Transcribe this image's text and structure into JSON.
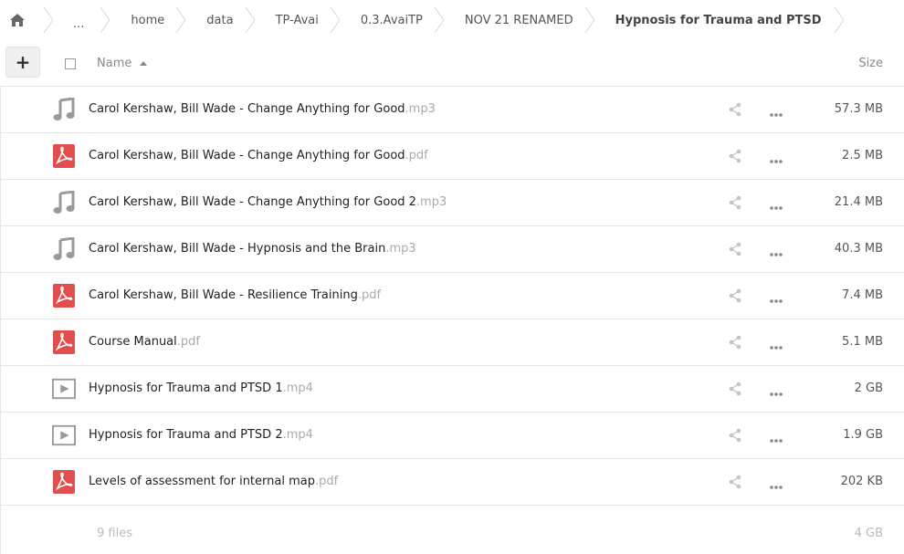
{
  "breadcrumb": {
    "home_icon": "home-icon",
    "ellipsis": "...",
    "items": [
      "home",
      "data",
      "TP-Avai",
      "0.3.AvaiTP",
      "NOV 21 RENAMED"
    ],
    "current": "Hypnosis for Trauma and PTSD"
  },
  "header": {
    "add_label": "+",
    "name_label": "Name",
    "size_label": "Size"
  },
  "files": [
    {
      "name": "Carol Kershaw, Bill Wade - Change Anything for Good",
      "ext": ".mp3",
      "type": "audio",
      "size": "57.3 MB"
    },
    {
      "name": "Carol Kershaw, Bill Wade - Change Anything for Good",
      "ext": ".pdf",
      "type": "pdf",
      "size": "2.5 MB"
    },
    {
      "name": "Carol Kershaw, Bill Wade - Change Anything for Good 2",
      "ext": ".mp3",
      "type": "audio",
      "size": "21.4 MB"
    },
    {
      "name": "Carol Kershaw, Bill Wade - Hypnosis and the Brain",
      "ext": ".mp3",
      "type": "audio",
      "size": "40.3 MB"
    },
    {
      "name": "Carol Kershaw, Bill Wade - Resilience Training",
      "ext": ".pdf",
      "type": "pdf",
      "size": "7.4 MB"
    },
    {
      "name": "Course Manual",
      "ext": ".pdf",
      "type": "pdf",
      "size": "5.1 MB"
    },
    {
      "name": "Hypnosis for Trauma and PTSD 1",
      "ext": ".mp4",
      "type": "video",
      "size": "2 GB"
    },
    {
      "name": "Hypnosis for Trauma and PTSD 2",
      "ext": ".mp4",
      "type": "video",
      "size": "1.9 GB"
    },
    {
      "name": "Levels of assessment for internal map",
      "ext": ".pdf",
      "type": "pdf",
      "size": "202 KB"
    }
  ],
  "footer": {
    "count": "9 files",
    "total": "4 GB"
  },
  "colors": {
    "pdf_red": "#e04e4e",
    "icon_gray": "#9a9a9a",
    "ext_gray": "#aaaaaa"
  }
}
